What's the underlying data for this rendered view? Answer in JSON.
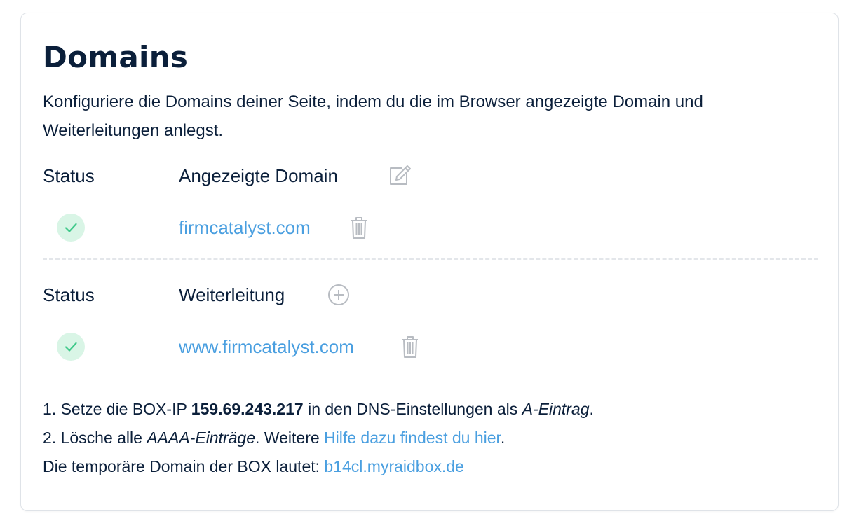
{
  "card": {
    "title": "Domains",
    "intro": "Konfiguriere die Domains deiner Seite, indem du die im Browser angezeigte Domain und Weiterleitungen anlegst."
  },
  "displayed_domain": {
    "status_header": "Status",
    "domain_header": "Angezeigte Domain",
    "header_action_icon": "edit-icon",
    "items": [
      {
        "status": "active",
        "domain": "firmcatalyst.com",
        "action_icon": "trash-icon"
      }
    ]
  },
  "redirects": {
    "status_header": "Status",
    "domain_header": "Weiterleitung",
    "header_action_icon": "plus-circle-icon",
    "items": [
      {
        "status": "active",
        "domain": "www.firmcatalyst.com",
        "action_icon": "trash-icon"
      }
    ]
  },
  "instructions": {
    "line1_prefix": "1. Setze die BOX-IP ",
    "box_ip": "159.69.243.217",
    "line1_middle": " in den DNS-Einstellungen als ",
    "line1_record": "A-Eintrag",
    "line1_suffix": ".",
    "line2_prefix": "2. Lösche alle ",
    "line2_record": "AAAA-Einträge",
    "line2_middle": ". Weitere ",
    "line2_link": "Hilfe dazu findest du hier",
    "line2_suffix": ".",
    "line3_prefix": "Die temporäre Domain der BOX lautet: ",
    "temp_domain": "b14cl.myraidbox.de"
  },
  "colors": {
    "heading": "#0b1f3a",
    "link": "#4a9fe0",
    "status_ok_bg": "#d9f5e6",
    "status_ok_check": "#3fc98a",
    "icon_gray": "#b8bcc2",
    "divider": "#e3e6ea"
  }
}
